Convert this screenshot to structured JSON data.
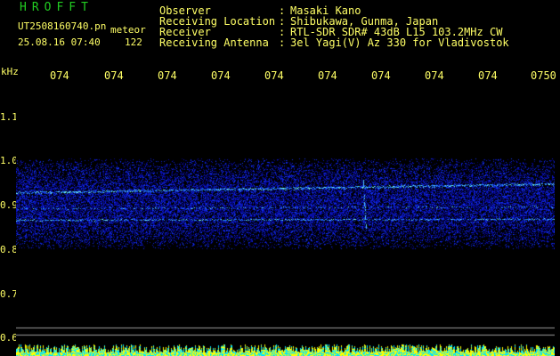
{
  "header": {
    "app_title": "HROFFT",
    "file_name": "UT2508160740.pn",
    "mode": "meteor",
    "date_time": "25.08.16 07:40",
    "count": "122"
  },
  "info": [
    {
      "label": "Observer",
      "value": "Masaki Kano"
    },
    {
      "label": "Receiving Location",
      "value": "Shibukawa, Gunma, Japan"
    },
    {
      "label": "Receiver",
      "value": "RTL-SDR SDR# 43dB L15 103.2MHz CW"
    },
    {
      "label": "Receiving Antenna",
      "value": "3el Yagi(V) Az 330 for Vladivostok"
    }
  ],
  "info_separator": ":",
  "axis": {
    "unit": "kHz",
    "y_ticks": [
      "1.1",
      "1.0",
      "0.9",
      "0.8",
      "0.7",
      "0.6"
    ],
    "x_ticks": [
      "074",
      "074",
      "074",
      "074",
      "074",
      "074",
      "074",
      "074",
      "074",
      "0750"
    ]
  },
  "colors": {
    "text_yellow": "#ffff66",
    "title_green": "#22cc22",
    "background": "#000000",
    "signal_blue": "#1a2fd0",
    "carrier_cyan": "#66ffee",
    "noise_floor_cyan": "#00e5ff",
    "noise_floor_yellow": "#ffff00"
  }
}
